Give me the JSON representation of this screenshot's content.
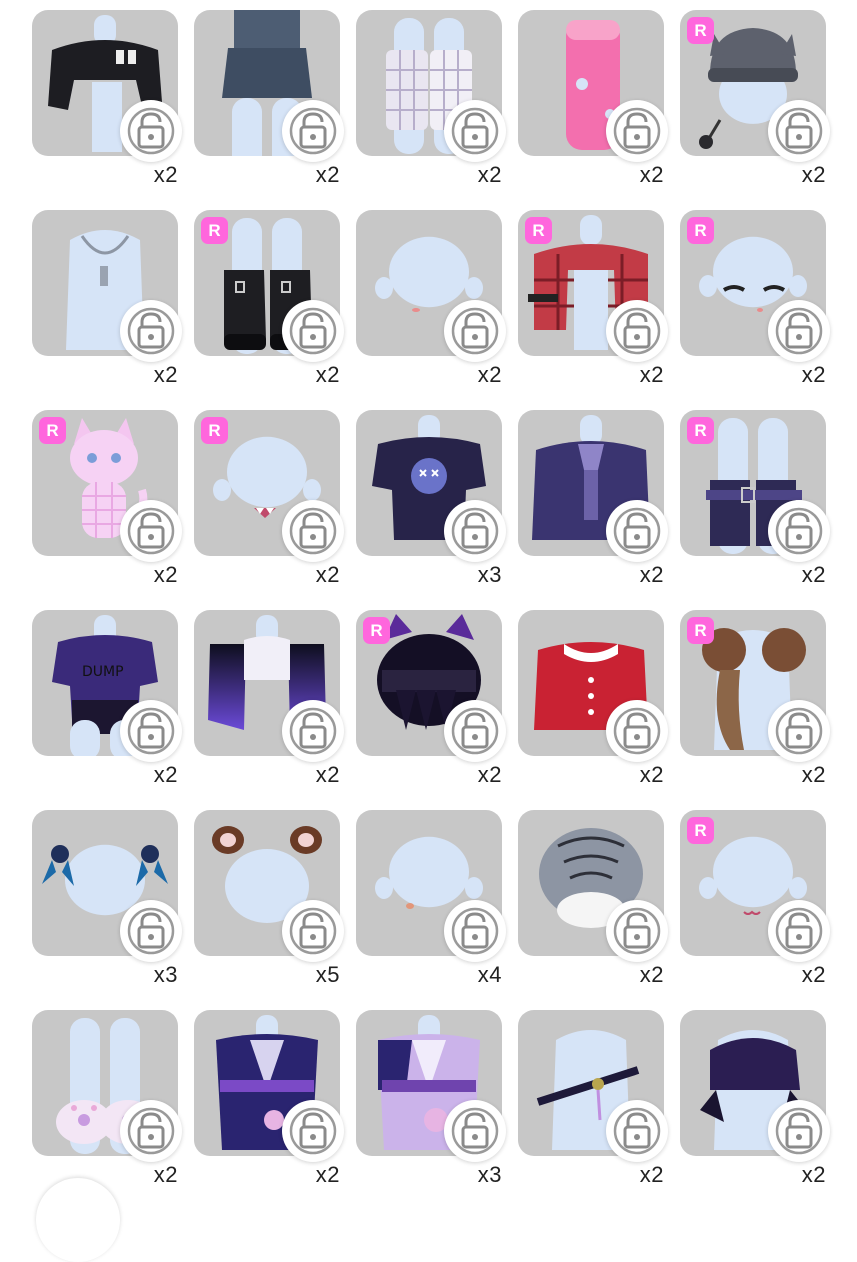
{
  "items": [
    {
      "count": "x2",
      "rare": false,
      "icon": "black-jacket-icon"
    },
    {
      "count": "x2",
      "rare": false,
      "icon": "denim-skirt-icon"
    },
    {
      "count": "x2",
      "rare": false,
      "icon": "plaid-leg-warmers-icon"
    },
    {
      "count": "x2",
      "rare": false,
      "icon": "pink-socks-icon"
    },
    {
      "count": "x2",
      "rare": true,
      "icon": "gray-cat-beanie-icon"
    },
    {
      "count": "x2",
      "rare": false,
      "icon": "chain-necklace-icon"
    },
    {
      "count": "x2",
      "rare": true,
      "icon": "black-platform-boots-icon"
    },
    {
      "count": "x2",
      "rare": false,
      "icon": "small-mouth-face-icon"
    },
    {
      "count": "x2",
      "rare": true,
      "icon": "red-plaid-jacket-icon"
    },
    {
      "count": "x2",
      "rare": true,
      "icon": "sleepy-eyes-face-icon"
    },
    {
      "count": "x2",
      "rare": true,
      "icon": "pink-cat-plush-icon"
    },
    {
      "count": "x2",
      "rare": true,
      "icon": "fang-mouth-face-icon"
    },
    {
      "count": "x3",
      "rare": false,
      "icon": "purple-graphic-tee-icon"
    },
    {
      "count": "x2",
      "rare": false,
      "icon": "purple-blazer-icon"
    },
    {
      "count": "x2",
      "rare": true,
      "icon": "purple-buckle-boots-icon"
    },
    {
      "count": "x2",
      "rare": false,
      "icon": "purple-print-tee-icon"
    },
    {
      "count": "x2",
      "rare": false,
      "icon": "gradient-sleeve-top-icon"
    },
    {
      "count": "x2",
      "rare": true,
      "icon": "cat-ear-hair-icon"
    },
    {
      "count": "x2",
      "rare": false,
      "icon": "red-collar-blouse-icon"
    },
    {
      "count": "x2",
      "rare": true,
      "icon": "fur-scarf-icon"
    },
    {
      "count": "x3",
      "rare": false,
      "icon": "blue-ribbon-clips-icon"
    },
    {
      "count": "x5",
      "rare": false,
      "icon": "brown-animal-ears-icon"
    },
    {
      "count": "x4",
      "rare": false,
      "icon": "nose-blush-face-icon"
    },
    {
      "count": "x2",
      "rare": false,
      "icon": "white-tiger-hood-icon"
    },
    {
      "count": "x2",
      "rare": true,
      "icon": "cat-mouth-face-icon"
    },
    {
      "count": "x2",
      "rare": false,
      "icon": "paw-slippers-icon"
    },
    {
      "count": "x2",
      "rare": false,
      "icon": "sakura-kimono-navy-icon"
    },
    {
      "count": "x3",
      "rare": false,
      "icon": "sakura-kimono-pink-icon"
    },
    {
      "count": "x2",
      "rare": false,
      "icon": "katana-belt-icon"
    },
    {
      "count": "x2",
      "rare": false,
      "icon": "dark-cropped-top-icon"
    }
  ],
  "badge_label": "R",
  "lock_icon": "unlock-icon",
  "colors": {
    "tile_bg": "#c7c7c7",
    "badge_bg": "#ff66dd",
    "body": "#d9e6f7"
  }
}
